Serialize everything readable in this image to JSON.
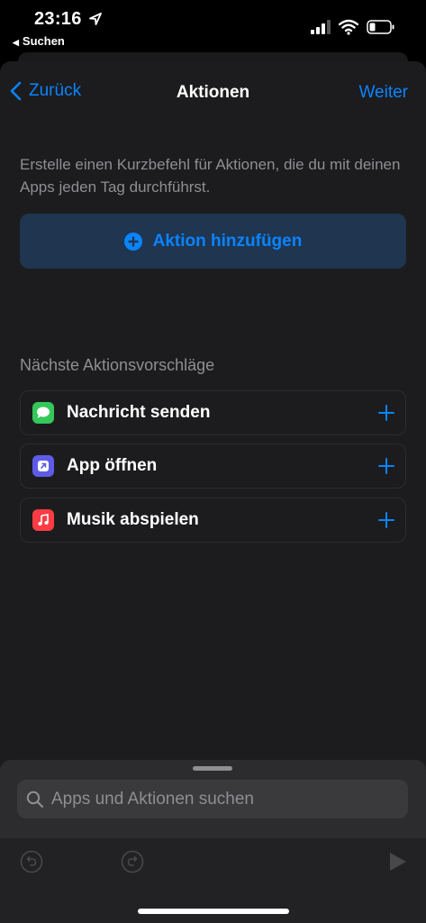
{
  "status_bar": {
    "time": "23:16",
    "back_app": "Suchen",
    "icons": [
      "location-arrow-icon",
      "signal-icon",
      "wifi-icon",
      "battery-icon"
    ]
  },
  "nav": {
    "back_label": "Zurück",
    "title": "Aktionen",
    "next_label": "Weiter"
  },
  "intro_text": "Erstelle einen Kurzbefehl für Aktionen, die du mit deinen Apps jeden Tag durchführst.",
  "add_action_label": "Aktion hinzufügen",
  "suggestions": {
    "title": "Nächste Aktionsvorschläge",
    "items": [
      {
        "label": "Nachricht senden",
        "icon": "messages-icon",
        "color": "#34c759"
      },
      {
        "label": "App öffnen",
        "icon": "open-app-icon",
        "color": "#5e5ce6"
      },
      {
        "label": "Musik abspielen",
        "icon": "music-icon",
        "color": "#fc3c44"
      }
    ]
  },
  "search": {
    "placeholder": "Apps und Aktionen suchen",
    "value": ""
  },
  "colors": {
    "accent": "#0a84ff",
    "background": "#1c1c1e",
    "button_bg": "#1f3550"
  }
}
